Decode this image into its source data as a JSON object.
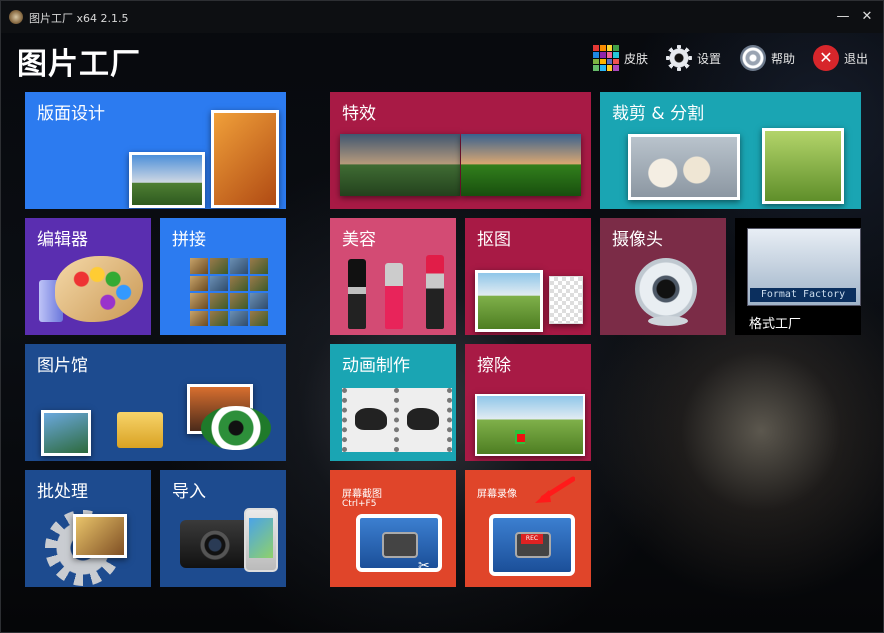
{
  "window": {
    "title": "图片工厂 x64 2.1.5",
    "minimize_glyph": "—",
    "close_glyph": "✕"
  },
  "app": {
    "title": "图片工厂"
  },
  "menu": {
    "skin_label": "皮肤",
    "settings_label": "设置",
    "help_label": "帮助",
    "exit_label": "退出",
    "exit_glyph": "✕"
  },
  "tiles": {
    "layout_design": "版面设计",
    "effects": "特效",
    "crop_split": "裁剪 & 分割",
    "editor": "编辑器",
    "stitch": "拼接",
    "beauty": "美容",
    "cutout": "抠图",
    "camera": "摄像头",
    "format_factory": "格式工厂",
    "format_factory_brand": "Format Factory",
    "gallery": "图片馆",
    "animation": "动画制作",
    "erase": "擦除",
    "batch": "批处理",
    "import": "导入",
    "screenshot": "屏幕截图",
    "screenshot_shortcut": "Ctrl+F5",
    "screen_record": "屏幕录像",
    "rec_badge": "REC"
  },
  "colors": {
    "blue": "#2c7bf0",
    "navy": "#1d4b8f",
    "purple": "#5a2eb0",
    "crimson": "#a81a45",
    "pink": "#d34b74",
    "teal": "#1aa5b3",
    "plum": "#7b2c47",
    "orange": "#e0452a",
    "arrow": "#ff1a1a"
  },
  "icons": {
    "skin": "skin-palette-icon",
    "settings": "gear-icon",
    "help": "help-gear-icon",
    "exit": "close-circle-icon"
  }
}
